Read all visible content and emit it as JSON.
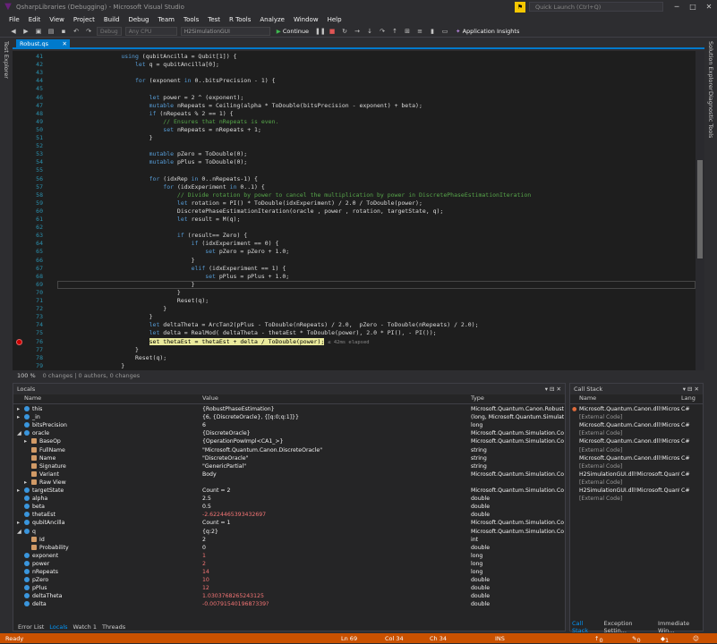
{
  "window": {
    "title": "QsharpLibraries (Debugging) - Microsoft Visual Studio",
    "quick_launch": "Quick Launch (Ctrl+Q)"
  },
  "menu": [
    "File",
    "Edit",
    "View",
    "Project",
    "Build",
    "Debug",
    "Team",
    "Tools",
    "Test",
    "R Tools",
    "Analyze",
    "Window",
    "Help"
  ],
  "toolbar": {
    "config": "Debug",
    "platform": "Any CPU",
    "project": "H2SimulationGUI",
    "continue": "Continue",
    "insights": "Application Insights"
  },
  "side_tabs": {
    "left": "Test Explorer",
    "right1": "Solution Explorer",
    "right2": "Diagnostic Tools"
  },
  "doc_tab": "Robust.qs",
  "code_lines": [
    {
      "n": "41",
      "t": "        using (qubitAncilla = Qubit[1]) {"
    },
    {
      "n": "42",
      "t": "            let q = qubitAncilla[0];"
    },
    {
      "n": "43",
      "t": ""
    },
    {
      "n": "44",
      "t": "            for (exponent in 0..bitsPrecision - 1) {"
    },
    {
      "n": "45",
      "t": ""
    },
    {
      "n": "46",
      "t": "                let power = 2 ^ (exponent);"
    },
    {
      "n": "47",
      "t": "                mutable nRepeats = Ceiling(alpha * ToDouble(bitsPrecision - exponent) + beta);"
    },
    {
      "n": "48",
      "t": "                if (nRepeats % 2 == 1) {"
    },
    {
      "n": "49",
      "t": "                    // Ensures that nRepeats is even."
    },
    {
      "n": "50",
      "t": "                    set nRepeats = nRepeats + 1;"
    },
    {
      "n": "51",
      "t": "                }"
    },
    {
      "n": "52",
      "t": ""
    },
    {
      "n": "53",
      "t": "                mutable pZero = ToDouble(0);"
    },
    {
      "n": "54",
      "t": "                mutable pPlus = ToDouble(0);"
    },
    {
      "n": "55",
      "t": ""
    },
    {
      "n": "56",
      "t": "                for (idxRep in 0..nRepeats-1) {"
    },
    {
      "n": "57",
      "t": "                    for (idxExperiment in 0..1) {"
    },
    {
      "n": "58",
      "t": "                        // Divide rotation by power to cancel the multiplication by power in DiscretePhaseEstimationIteration"
    },
    {
      "n": "59",
      "t": "                        let rotation = PI() * ToDouble(idxExperiment) / 2.0 / ToDouble(power);"
    },
    {
      "n": "60",
      "t": "                        DiscretePhaseEstimationIteration(oracle , power , rotation, targetState, q);"
    },
    {
      "n": "61",
      "t": "                        let result = M(q);"
    },
    {
      "n": "62",
      "t": ""
    },
    {
      "n": "63",
      "t": "                        if (result== Zero) {"
    },
    {
      "n": "64",
      "t": "                            if (idxExperiment == 0) {"
    },
    {
      "n": "65",
      "t": "                                set pZero = pZero + 1.0;"
    },
    {
      "n": "66",
      "t": "                            }"
    },
    {
      "n": "67",
      "t": "                            elif (idxExperiment == 1) {"
    },
    {
      "n": "68",
      "t": "                                set pPlus = pPlus + 1.0;"
    },
    {
      "n": "69",
      "t": "                            }"
    },
    {
      "n": "70",
      "t": "                        }"
    },
    {
      "n": "71",
      "t": "                        Reset(q);"
    },
    {
      "n": "72",
      "t": "                    }"
    },
    {
      "n": "73",
      "t": "                }"
    },
    {
      "n": "74",
      "t": "                let deltaTheta = ArcTan2(pPlus - ToDouble(nRepeats) / 2.0,  pZero - ToDouble(nRepeats) / 2.0);"
    },
    {
      "n": "75",
      "t": "                let delta = RealMod( deltaTheta - thetaEst * ToDouble(power), 2.0 * PI(), - PI());"
    },
    {
      "n": "76",
      "t": "                set thetaEst = thetaEst + delta / ToDouble(power);"
    },
    {
      "n": "77",
      "t": "            }"
    },
    {
      "n": "78",
      "t": "            Reset(q);"
    },
    {
      "n": "79",
      "t": "        }"
    }
  ],
  "elapsed": "≤ 42ms elapsed",
  "editor_status": {
    "zoom": "100 %",
    "changes": "0 changes | 0 authors, 0 changes"
  },
  "locals": {
    "title": "Locals",
    "headers": {
      "name": "Name",
      "value": "Value",
      "type": "Type"
    },
    "rows": [
      {
        "name": "this",
        "value": "{RobustPhaseEstimation}",
        "type": "Microsoft.Quantum.Canon.RobustP",
        "ind": 1,
        "exp": "▸",
        "ch": false
      },
      {
        "name": "_in",
        "value": "{6, {DiscreteOracle}, {[q:0;q:1]}}",
        "type": "(long, Microsoft.Quantum.Simulat",
        "ind": 1,
        "exp": "▸",
        "ch": false
      },
      {
        "name": "bitsPrecision",
        "value": "6",
        "type": "long",
        "ind": 1,
        "exp": "",
        "ch": false
      },
      {
        "name": "oracle",
        "value": "{DiscreteOracle}",
        "type": "Microsoft.Quantum.Simulation.Co",
        "ind": 1,
        "exp": "◢",
        "ch": false
      },
      {
        "name": "BaseOp",
        "value": "{OperationPowImpl<CA1_>}",
        "type": "Microsoft.Quantum.Simulation.Co",
        "ind": 2,
        "exp": "▸",
        "ch": false
      },
      {
        "name": "FullName",
        "value": "\"Microsoft.Quantum.Canon.DiscreteOracle\"",
        "type": "string",
        "ind": 2,
        "exp": "",
        "ch": false
      },
      {
        "name": "Name",
        "value": "\"DiscreteOracle\"",
        "type": "string",
        "ind": 2,
        "exp": "",
        "ch": false
      },
      {
        "name": "Signature",
        "value": "\"GenericPartial\"",
        "type": "string",
        "ind": 2,
        "exp": "",
        "ch": false
      },
      {
        "name": "Variant",
        "value": "Body",
        "type": "Microsoft.Quantum.Simulation.Co",
        "ind": 2,
        "exp": "",
        "ch": false
      },
      {
        "name": "Raw View",
        "value": "",
        "type": "",
        "ind": 2,
        "exp": "▸",
        "ch": false
      },
      {
        "name": "targetState",
        "value": "Count = 2",
        "type": "Microsoft.Quantum.Simulation.Co",
        "ind": 1,
        "exp": "▸",
        "ch": false
      },
      {
        "name": "alpha",
        "value": "2.5",
        "type": "double",
        "ind": 1,
        "exp": "",
        "ch": false
      },
      {
        "name": "beta",
        "value": "0.5",
        "type": "double",
        "ind": 1,
        "exp": "",
        "ch": false
      },
      {
        "name": "thetaEst",
        "value": "-2.6224465393432697",
        "type": "double",
        "ind": 1,
        "exp": "",
        "ch": true
      },
      {
        "name": "qubitAncilla",
        "value": "Count = 1",
        "type": "Microsoft.Quantum.Simulation.Co",
        "ind": 1,
        "exp": "▸",
        "ch": false
      },
      {
        "name": "q",
        "value": "{q:2}",
        "type": "Microsoft.Quantum.Simulation.Co",
        "ind": 1,
        "exp": "◢",
        "ch": false
      },
      {
        "name": "Id",
        "value": "2",
        "type": "int",
        "ind": 2,
        "exp": "",
        "ch": false
      },
      {
        "name": "Probability",
        "value": "0",
        "type": "double",
        "ind": 2,
        "exp": "",
        "ch": false
      },
      {
        "name": "exponent",
        "value": "1",
        "type": "long",
        "ind": 1,
        "exp": "",
        "ch": true
      },
      {
        "name": "power",
        "value": "2",
        "type": "long",
        "ind": 1,
        "exp": "",
        "ch": true
      },
      {
        "name": "nRepeats",
        "value": "14",
        "type": "long",
        "ind": 1,
        "exp": "",
        "ch": true
      },
      {
        "name": "pZero",
        "value": "10",
        "type": "double",
        "ind": 1,
        "exp": "",
        "ch": true
      },
      {
        "name": "pPlus",
        "value": "12",
        "type": "double",
        "ind": 1,
        "exp": "",
        "ch": true
      },
      {
        "name": "deltaTheta",
        "value": "1.0303768265243125",
        "type": "double",
        "ind": 1,
        "exp": "",
        "ch": true
      },
      {
        "name": "delta",
        "value": "-0.0079154019687339?",
        "type": "double",
        "ind": 1,
        "exp": "",
        "ch": true
      }
    ]
  },
  "callstack": {
    "title": "Call Stack",
    "headers": {
      "name": "Name",
      "lang": "Lang"
    },
    "rows": [
      {
        "name": "Microsoft.Quantum.Canon.dll!Microsoft",
        "lang": "C#",
        "ext": false
      },
      {
        "name": "[External Code]",
        "lang": "",
        "ext": true
      },
      {
        "name": "Microsoft.Quantum.Canon.dll!Microsoft",
        "lang": "C#",
        "ext": false
      },
      {
        "name": "[External Code]",
        "lang": "",
        "ext": true
      },
      {
        "name": "Microsoft.Quantum.Canon.dll!Microsoft",
        "lang": "C#",
        "ext": false
      },
      {
        "name": "[External Code]",
        "lang": "",
        "ext": true
      },
      {
        "name": "Microsoft.Quantum.Canon.dll!Microsoft",
        "lang": "C#",
        "ext": false
      },
      {
        "name": "[External Code]",
        "lang": "",
        "ext": true
      },
      {
        "name": "H2SimulationGUI.dll!Microsoft.Quantur",
        "lang": "C#",
        "ext": false
      },
      {
        "name": "[External Code]",
        "lang": "",
        "ext": true
      },
      {
        "name": "H2SimulationGUI.dll!Microsoft.Quantur",
        "lang": "C#",
        "ext": false
      },
      {
        "name": "[External Code]",
        "lang": "",
        "ext": true
      }
    ]
  },
  "bottom_tabs": [
    "Error List",
    "Locals",
    "Watch 1",
    "Threads"
  ],
  "cs_tabs": [
    "Call Stack",
    "Exception Settin...",
    "Immediate Win..."
  ],
  "status": {
    "ready": "Ready",
    "ln": "Ln 69",
    "col": "Col 34",
    "ch": "Ch 34",
    "ins": "INS",
    "up": "0",
    "edit": "0",
    "warn": "1"
  }
}
